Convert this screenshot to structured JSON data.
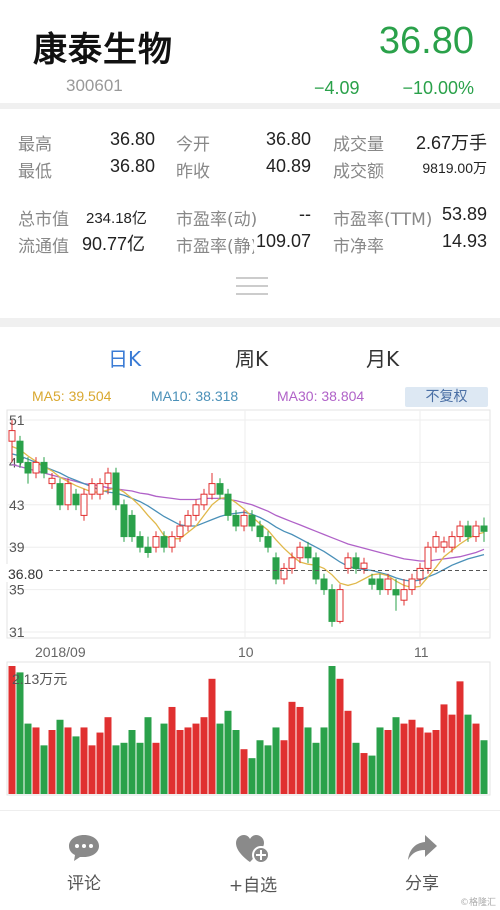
{
  "stock": {
    "name": "康泰生物",
    "code": "300601",
    "price": "36.80",
    "change": "−4.09",
    "change_pct": "−10.00%"
  },
  "stats": [
    {
      "label": "最高",
      "value": "36.80"
    },
    {
      "label": "今开",
      "value": "36.80"
    },
    {
      "label": "成交量",
      "value": "2.67万手"
    },
    {
      "label": "最低",
      "value": "36.80"
    },
    {
      "label": "昨收",
      "value": "40.89"
    },
    {
      "label": "成交额",
      "value": "9819.00万"
    },
    {
      "label": "总市值",
      "value": "234.18亿"
    },
    {
      "label": "市盈率(动)",
      "value": "--"
    },
    {
      "label": "市盈率(TTM)",
      "value": "53.89"
    },
    {
      "label": "流通值",
      "value": "90.77亿"
    },
    {
      "label": "市盈率(静)",
      "value": "109.07"
    },
    {
      "label": "市净率",
      "value": "14.93"
    }
  ],
  "tabs": [
    "日K",
    "周K",
    "月K"
  ],
  "ma": {
    "ma5": "MA5: 39.504",
    "ma10": "MA10: 38.318",
    "ma30": "MA30: 38.804",
    "adjust": "不复权"
  },
  "colors": {
    "up": "#e03030",
    "down": "#2aa14a",
    "ma5": "#e0b84a",
    "ma10": "#4a90b8",
    "ma30": "#b062c8",
    "accent": "#3a7bd5"
  },
  "bottom": {
    "comment": "评论",
    "watch": "+自选",
    "share": "分享"
  },
  "watermark": "©格隆汇",
  "chart_data": {
    "type": "candlestick",
    "y_ticks": [
      "51",
      "47",
      "43",
      "39",
      "35",
      "31"
    ],
    "x_ticks": [
      "2018/09",
      "10",
      "11"
    ],
    "current_price_label": "36.80",
    "volume_label": "2.13万元",
    "ylim": [
      31,
      51
    ],
    "candles": [
      [
        49,
        50,
        47,
        51
      ],
      [
        49,
        47,
        46.5,
        49.5
      ],
      [
        47,
        46,
        45,
        47.5
      ],
      [
        46,
        47,
        45.5,
        47.5
      ],
      [
        47,
        46,
        45.5,
        47.5
      ],
      [
        45,
        45.5,
        44.5,
        46
      ],
      [
        45,
        43,
        42.5,
        45.5
      ],
      [
        43,
        45,
        42.5,
        45.5
      ],
      [
        44,
        43,
        42.5,
        44.5
      ],
      [
        42,
        44,
        41.5,
        44.5
      ],
      [
        44,
        45,
        43.5,
        45.5
      ],
      [
        44,
        45,
        43.5,
        45.5
      ],
      [
        45,
        46,
        44,
        46.5
      ],
      [
        46,
        43,
        42.5,
        46.5
      ],
      [
        43,
        40,
        39.5,
        43.5
      ],
      [
        42,
        40,
        39.5,
        42.5
      ],
      [
        40,
        39,
        38.5,
        40.5
      ],
      [
        39,
        38.5,
        38,
        40
      ],
      [
        39,
        40,
        38.5,
        40.5
      ],
      [
        40,
        39,
        38.5,
        40.5
      ],
      [
        39,
        40,
        38.5,
        40.5
      ],
      [
        40,
        41,
        39.5,
        41.5
      ],
      [
        41,
        42,
        40.5,
        42.5
      ],
      [
        42,
        43,
        41.5,
        43.5
      ],
      [
        43,
        44,
        42.5,
        44.5
      ],
      [
        44,
        45,
        43.5,
        46
      ],
      [
        45,
        44,
        43.5,
        45.5
      ],
      [
        44,
        42,
        41.5,
        44.5
      ],
      [
        42,
        41,
        40.5,
        42.5
      ],
      [
        41,
        42,
        40.5,
        42.5
      ],
      [
        42,
        41,
        40.5,
        42.5
      ],
      [
        41,
        40,
        39.5,
        41.5
      ],
      [
        40,
        39,
        38.5,
        40.5
      ],
      [
        38,
        36,
        35.5,
        38.5
      ],
      [
        36,
        37,
        35.5,
        37.5
      ],
      [
        37,
        38,
        36.5,
        38.5
      ],
      [
        38,
        39,
        37.5,
        39.5
      ],
      [
        39,
        38,
        37.5,
        39.5
      ],
      [
        38,
        36,
        35.5,
        38.5
      ],
      [
        36,
        35,
        34.5,
        36.5
      ],
      [
        35,
        32,
        31.5,
        35.5
      ],
      [
        32,
        35,
        31.8,
        35.5
      ],
      [
        37,
        38,
        36.5,
        38.5
      ],
      [
        38,
        37,
        36.5,
        38.5
      ],
      [
        37,
        37.5,
        36.5,
        38
      ],
      [
        36,
        35.5,
        35,
        36.5
      ],
      [
        36,
        35,
        34.5,
        36.5
      ],
      [
        35,
        36,
        34.5,
        36.5
      ],
      [
        35,
        34.5,
        33,
        36
      ],
      [
        34,
        35,
        33.5,
        36
      ],
      [
        35,
        36,
        34.5,
        36.5
      ],
      [
        36,
        37,
        35.5,
        37.5
      ],
      [
        37,
        39,
        36.5,
        39.5
      ],
      [
        39,
        40,
        38.5,
        40.5
      ],
      [
        39,
        39.5,
        38.5,
        40
      ],
      [
        39,
        40,
        38.5,
        40.5
      ],
      [
        40,
        41,
        39.5,
        41.5
      ],
      [
        41,
        40,
        39.5,
        41.5
      ],
      [
        40,
        41,
        39.5,
        41.5
      ],
      [
        41,
        40.5,
        39.5,
        41.8
      ]
    ],
    "ma5": [
      48.5,
      48.2,
      47.6,
      47.1,
      46.6,
      46.2,
      45.6,
      45.2,
      44.8,
      44.5,
      44.2,
      44.2,
      44.4,
      44.6,
      44.2,
      43.6,
      42.9,
      42.0,
      41.2,
      40.1,
      39.8,
      39.8,
      40.4,
      41.0,
      42.0,
      43.0,
      43.6,
      43.7,
      43.2,
      42.6,
      41.9,
      41.2,
      40.6,
      39.7,
      38.9,
      38.2,
      37.6,
      37.4,
      37.3,
      37.0,
      36.4,
      35.6,
      35.4,
      35.6,
      36.0,
      36.4,
      36.5,
      36.3,
      35.8,
      35.4,
      35.2,
      35.3,
      36.2,
      37.1,
      38.1,
      38.7,
      39.3,
      39.8,
      40.2,
      40.4
    ],
    "ma10": [
      47.8,
      47.6,
      47.3,
      47.0,
      46.6,
      46.3,
      46.0,
      45.6,
      45.3,
      45.0,
      44.7,
      44.4,
      44.2,
      44.1,
      43.9,
      43.6,
      43.3,
      42.9,
      42.4,
      41.9,
      41.5,
      41.1,
      41.0,
      41.0,
      41.3,
      41.6,
      41.9,
      42.1,
      42.2,
      42.3,
      42.1,
      41.8,
      41.4,
      40.9,
      40.5,
      40.2,
      39.8,
      39.4,
      39.0,
      38.6,
      38.1,
      37.6,
      37.2,
      37.0,
      36.9,
      36.8,
      36.6,
      36.4,
      36.1,
      35.9,
      35.8,
      35.9,
      36.2,
      36.5,
      36.9,
      37.3,
      37.6,
      37.9,
      38.1,
      38.3
    ],
    "ma30": [
      46.8,
      46.6,
      46.4,
      46.2,
      46.0,
      45.8,
      45.6,
      45.4,
      45.2,
      45.0,
      44.9,
      44.8,
      44.6,
      44.5,
      44.4,
      44.3,
      44.1,
      44.0,
      43.8,
      43.7,
      43.6,
      43.5,
      43.5,
      43.5,
      43.6,
      43.6,
      43.6,
      43.5,
      43.4,
      43.2,
      43.0,
      42.7,
      42.4,
      42.0,
      41.7,
      41.4,
      41.1,
      40.8,
      40.5,
      40.2,
      39.9,
      39.6,
      39.3,
      39.1,
      38.9,
      38.7,
      38.5,
      38.3,
      38.1,
      37.9,
      37.8,
      37.7,
      37.7,
      37.8,
      37.9,
      38.0,
      38.1,
      38.3,
      38.5,
      38.8
    ],
    "volume": [
      100,
      95,
      55,
      52,
      38,
      50,
      58,
      52,
      45,
      52,
      38,
      48,
      60,
      38,
      40,
      50,
      40,
      60,
      40,
      55,
      68,
      50,
      52,
      55,
      60,
      90,
      55,
      65,
      50,
      35,
      28,
      42,
      38,
      52,
      42,
      72,
      68,
      52,
      40,
      52,
      100,
      90,
      65,
      40,
      32,
      30,
      52,
      50,
      60,
      55,
      58,
      52,
      48,
      50,
      70,
      62,
      88,
      62,
      55,
      42
    ]
  }
}
